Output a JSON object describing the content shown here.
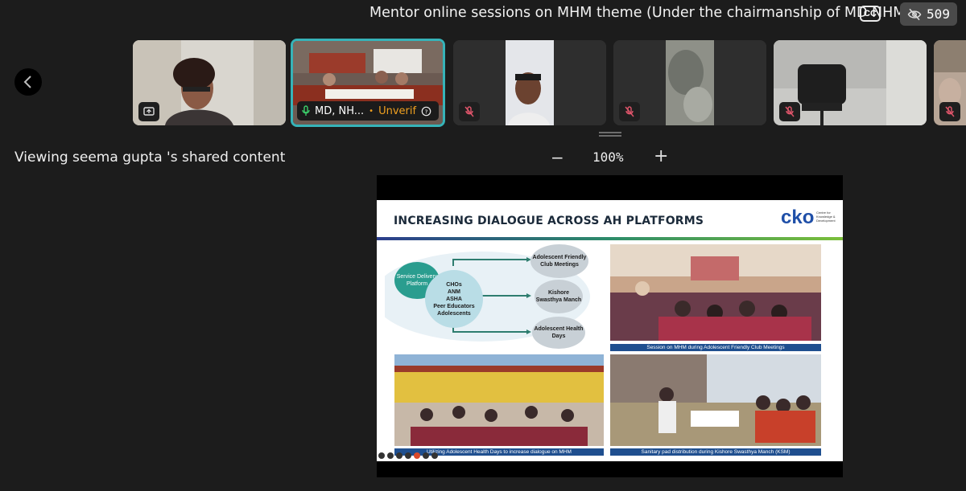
{
  "header": {
    "meeting_title": "Mentor online sessions on MHM theme (Under the chairmanship of MD NHM)",
    "cc_label": "CC",
    "viewer_count": "509",
    "cc_icon": "closed-captions-icon",
    "viewer_icon": "eye-off-icon"
  },
  "filmstrip": {
    "prev_icon": "chevron-left-icon",
    "active_tile": {
      "name": "MD, NH...",
      "status": "Unverif",
      "mic_icon": "mic-on-icon",
      "info_icon": "help-circle-icon"
    },
    "muted_icon": "mic-off-icon",
    "share_icon": "screen-share-icon"
  },
  "share_bar": {
    "viewing_text": "Viewing seema gupta 's shared content",
    "zoom_out_label": "−",
    "zoom_level": "100%",
    "zoom_in_label": "+"
  },
  "slide": {
    "title": "INCREASING DIALOGUE ACROSS AH PLATFORMS",
    "logo_text": "cko",
    "logo_subtext": "Centre for Knowledge & Development",
    "diagram": {
      "platform": "Service Delivery Platform",
      "actors": [
        "CHOs",
        "ANM",
        "ASHA",
        "Peer Educators",
        "Adolescents"
      ],
      "targets": [
        "Adolescent Friendly Club Meetings",
        "Kishore Swasthya Manch",
        "Adolescent Health Days"
      ]
    },
    "captions": {
      "top_right": "Session on MHM during Adolescent Friendly Club Meetings",
      "bottom_left": "Utilizing Adolescent Health Days to increase dialogue on MHM",
      "bottom_right": "Sanitary pad distribution during Kishore Swasthya Manch (KSM)"
    }
  }
}
